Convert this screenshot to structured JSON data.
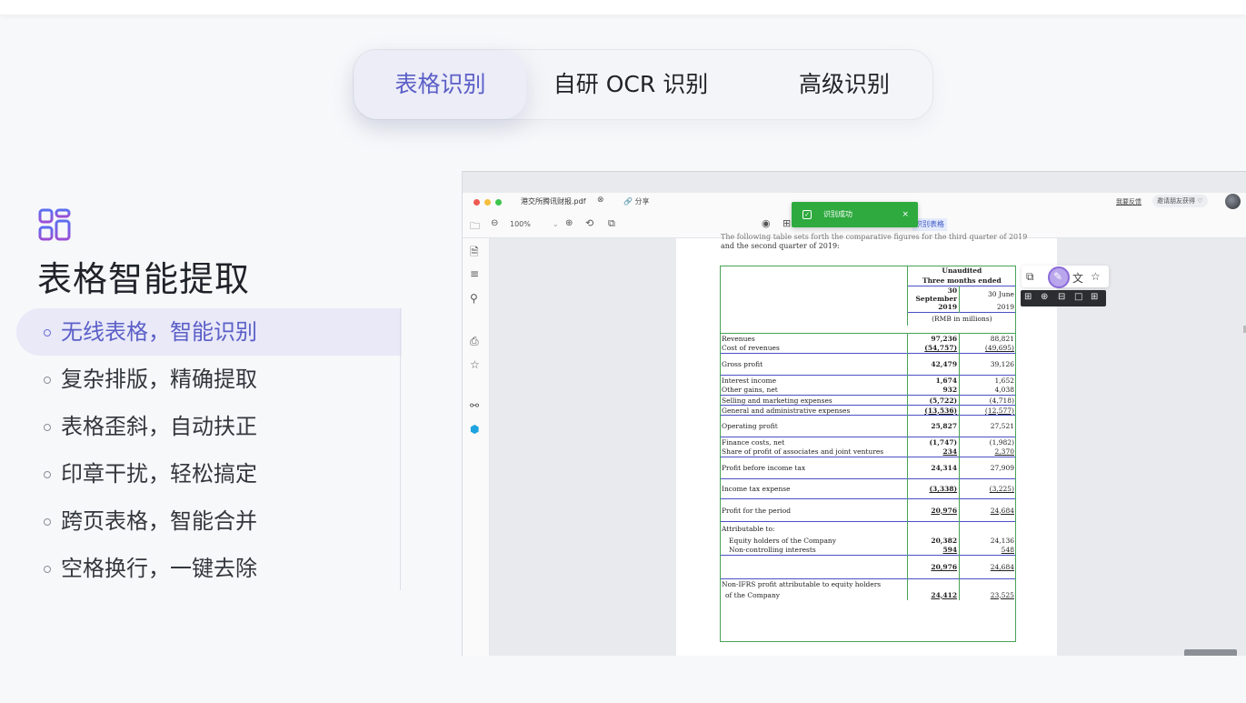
{
  "tabs": [
    {
      "label": "表格识别",
      "active": true
    },
    {
      "label": "自研 OCR 识别",
      "active": false
    },
    {
      "label": "高级识别",
      "active": false
    }
  ],
  "feature": {
    "icon": "layout-grid-icon",
    "title": "表格智能提取",
    "items": [
      {
        "label": "无线表格，智能识别",
        "active": true
      },
      {
        "label": "复杂排版，精确提取",
        "active": false
      },
      {
        "label": "表格歪斜，自动扶正",
        "active": false
      },
      {
        "label": "印章干扰，轻松搞定",
        "active": false
      },
      {
        "label": "跨页表格，智能合并",
        "active": false
      },
      {
        "label": "空格换行，一键去除",
        "active": false
      }
    ]
  },
  "app": {
    "file_name": "港交所腾讯财报.pdf",
    "close_glyph": "⊗",
    "share_label": "🔗 分享",
    "feedback_label": "我要反馈",
    "invite_label": "邀请朋友获得 ♡",
    "zoom_label": "100%",
    "toast_label": "识别成功",
    "toast_close": "×",
    "toast_check": "✓",
    "recog_tag": "识别表格",
    "colors": {
      "accent": "#5b5fc7",
      "toast": "#2eaa3f",
      "table_border": "#48a358",
      "grid": "#4b50c5"
    }
  },
  "document": {
    "intro_line_cut": "The following table sets forth the comparative figures for the third quarter of 2019",
    "intro_line": "and the second quarter of 2019:",
    "header": {
      "unaudited": "Unaudited",
      "three_months": "Three months ended",
      "col1_date": "30 September",
      "col1_year": "2019",
      "col2_date": "30 June",
      "col2_year": "2019",
      "unit": "(RMB in millions)"
    },
    "rows": [
      {
        "label": "Revenues",
        "v1": "97,236",
        "v2": "88,821"
      },
      {
        "label": "Cost of revenues",
        "v1": "(54,757)",
        "v2": "(49,695)"
      },
      {
        "label": "Gross profit",
        "v1": "42,479",
        "v2": "39,126"
      },
      {
        "label": "Interest income",
        "v1": "1,674",
        "v2": "1,652"
      },
      {
        "label": "Other gains, net",
        "v1": "932",
        "v2": "4,038"
      },
      {
        "label": "Selling and marketing expenses",
        "v1": "(5,722)",
        "v2": "(4,718)"
      },
      {
        "label": "General and administrative expenses",
        "v1": "(13,536)",
        "v2": "(12,577)"
      },
      {
        "label": "Operating profit",
        "v1": "25,827",
        "v2": "27,521"
      },
      {
        "label": "Finance costs, net",
        "v1": "(1,747)",
        "v2": "(1,982)"
      },
      {
        "label": "Share of profit of associates and joint ventures",
        "v1": "234",
        "v2": "2,370"
      },
      {
        "label": "Profit before income tax",
        "v1": "24,314",
        "v2": "27,909"
      },
      {
        "label": "Income tax expense",
        "v1": "(3,338)",
        "v2": "(3,225)"
      },
      {
        "label": "Profit for the period",
        "v1": "20,976",
        "v2": "24,684"
      },
      {
        "label": "Attributable to:",
        "v1": "",
        "v2": ""
      },
      {
        "label": "Equity holders of the Company",
        "v1": "20,382",
        "v2": "24,136"
      },
      {
        "label": "Non-controlling interests",
        "v1": "594",
        "v2": "548"
      },
      {
        "label": "",
        "v1": "20,976",
        "v2": "24,684"
      },
      {
        "label": "Non-IFRS profit attributable to equity holders",
        "v1": "",
        "v2": ""
      },
      {
        "label": "of the Company",
        "v1": "24,412",
        "v2": "23,525"
      }
    ]
  }
}
